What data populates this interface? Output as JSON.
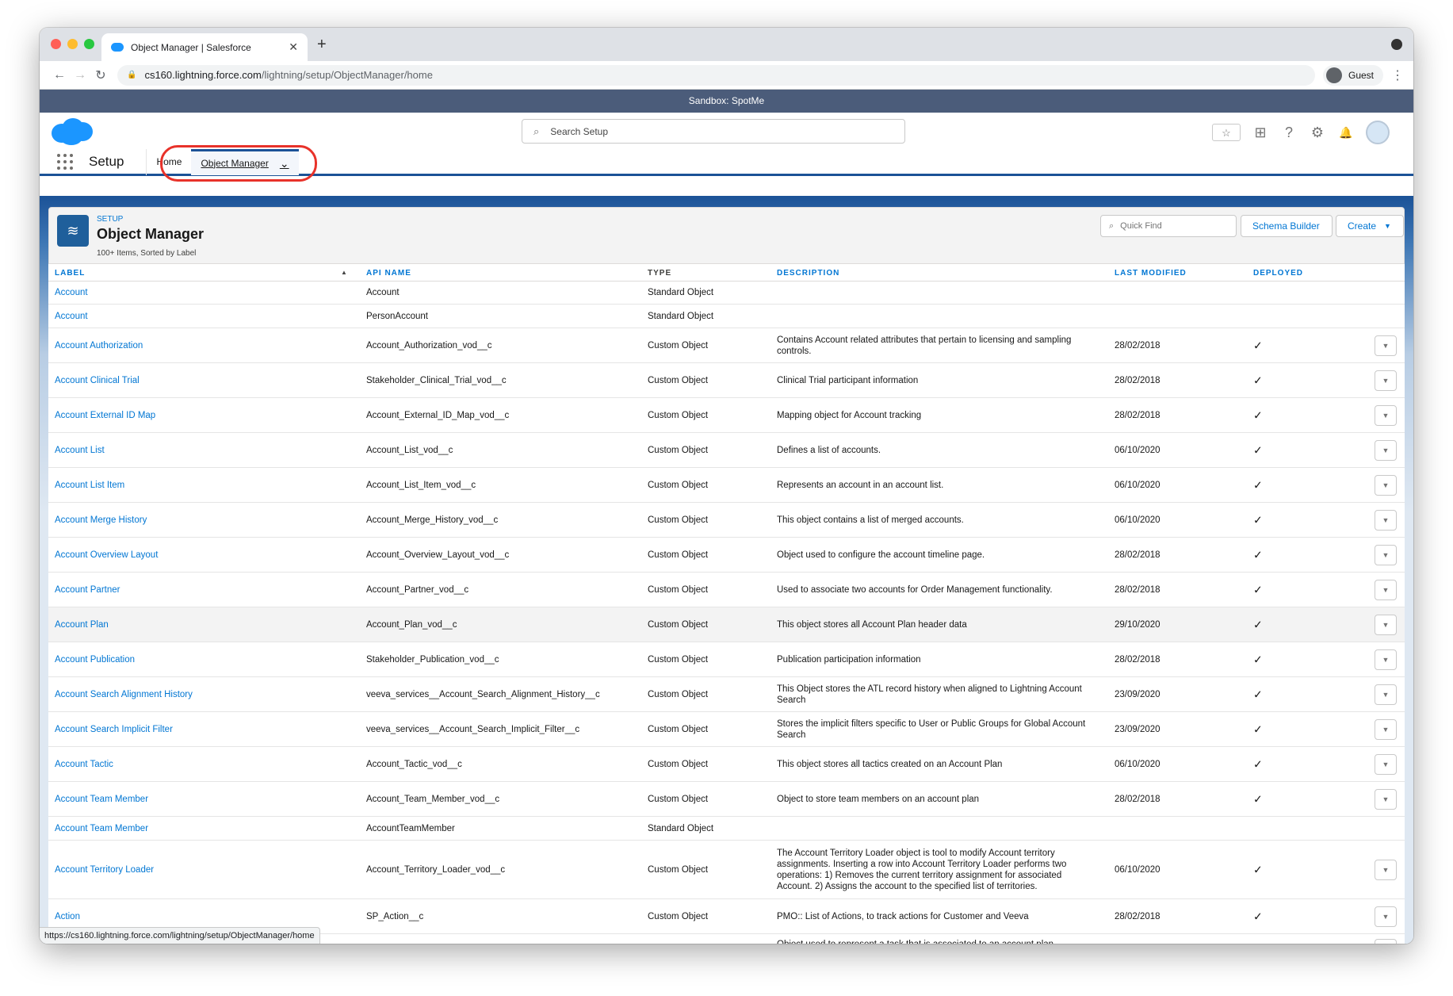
{
  "browser": {
    "tab_title": "Object Manager | Salesforce",
    "tab_close": "✕",
    "new_tab": "+",
    "url_host": "cs160.lightning.force.com",
    "url_path": "/lightning/setup/ObjectManager/home",
    "profile": "Guest",
    "status_url": "https://cs160.lightning.force.com/lightning/setup/ObjectManager/home",
    "back": "←",
    "forward": "→",
    "reload": "↻",
    "kebab": "⋮"
  },
  "sandbox_banner": "Sandbox: SpotMe",
  "header": {
    "search_placeholder": "Search Setup",
    "search_icon": "⌕",
    "icons": [
      "☆",
      "⊞",
      "?",
      "⚙",
      "🔔"
    ]
  },
  "appnav": {
    "app_name": "Setup",
    "home_label": "Home",
    "active_tab": "Object Manager",
    "chevron": "⌄"
  },
  "page": {
    "setup_label": "SETUP",
    "title": "Object Manager",
    "subtitle": "100+ Items, Sorted by Label",
    "quick_find_placeholder": "Quick Find",
    "schema_builder": "Schema Builder",
    "create": "Create",
    "create_caret": "▼"
  },
  "table": {
    "columns": {
      "label": "LABEL",
      "sort_arrow": "▲",
      "api_name": "API NAME",
      "type": "TYPE",
      "description": "DESCRIPTION",
      "last_modified": "LAST MODIFIED",
      "deployed": "DEPLOYED"
    },
    "rows": [
      {
        "label": "Account",
        "api": "Account",
        "type": "Standard Object",
        "desc": "",
        "mod": "",
        "dep": "",
        "action": false,
        "h": 29
      },
      {
        "label": "Account",
        "api": "PersonAccount",
        "type": "Standard Object",
        "desc": "",
        "mod": "",
        "dep": "",
        "action": false,
        "h": 30
      },
      {
        "label": "Account Authorization",
        "api": "Account_Authorization_vod__c",
        "type": "Custom Object",
        "desc": "Contains Account related attributes that pertain to licensing and sampling controls.",
        "mod": "28/02/2018",
        "dep": "✓",
        "action": true,
        "h": 44
      },
      {
        "label": "Account Clinical Trial",
        "api": "Stakeholder_Clinical_Trial_vod__c",
        "type": "Custom Object",
        "desc": "Clinical Trial participant information",
        "mod": "28/02/2018",
        "dep": "✓",
        "action": true,
        "h": 44
      },
      {
        "label": "Account External ID Map",
        "api": "Account_External_ID_Map_vod__c",
        "type": "Custom Object",
        "desc": "Mapping object for Account tracking",
        "mod": "28/02/2018",
        "dep": "✓",
        "action": true,
        "h": 44
      },
      {
        "label": "Account List",
        "api": "Account_List_vod__c",
        "type": "Custom Object",
        "desc": "Defines a list of accounts.",
        "mod": "06/10/2020",
        "dep": "✓",
        "action": true,
        "h": 44
      },
      {
        "label": "Account List Item",
        "api": "Account_List_Item_vod__c",
        "type": "Custom Object",
        "desc": "Represents an account in an account list.",
        "mod": "06/10/2020",
        "dep": "✓",
        "action": true,
        "h": 44
      },
      {
        "label": "Account Merge History",
        "api": "Account_Merge_History_vod__c",
        "type": "Custom Object",
        "desc": "This object contains a list of merged accounts.",
        "mod": "06/10/2020",
        "dep": "✓",
        "action": true,
        "h": 44
      },
      {
        "label": "Account Overview Layout",
        "api": "Account_Overview_Layout_vod__c",
        "type": "Custom Object",
        "desc": "Object used to configure the account timeline page.",
        "mod": "28/02/2018",
        "dep": "✓",
        "action": true,
        "h": 44
      },
      {
        "label": "Account Partner",
        "api": "Account_Partner_vod__c",
        "type": "Custom Object",
        "desc": "Used to associate two accounts for Order Management functionality.",
        "mod": "28/02/2018",
        "dep": "✓",
        "action": true,
        "h": 44
      },
      {
        "label": "Account Plan",
        "api": "Account_Plan_vod__c",
        "type": "Custom Object",
        "desc": "This object stores all Account Plan header data",
        "mod": "29/10/2020",
        "dep": "✓",
        "action": true,
        "h": 44,
        "hl": true
      },
      {
        "label": "Account Publication",
        "api": "Stakeholder_Publication_vod__c",
        "type": "Custom Object",
        "desc": "Publication participation information",
        "mod": "28/02/2018",
        "dep": "✓",
        "action": true,
        "h": 44
      },
      {
        "label": "Account Search Alignment History",
        "api": "veeva_services__Account_Search_Alignment_History__c",
        "type": "Custom Object",
        "desc": "This Object stores the ATL record history when aligned to Lightning Account Search",
        "mod": "23/09/2020",
        "dep": "✓",
        "action": true,
        "h": 44
      },
      {
        "label": "Account Search Implicit Filter",
        "api": "veeva_services__Account_Search_Implicit_Filter__c",
        "type": "Custom Object",
        "desc": "Stores the implicit filters specific to User or Public Groups for Global Account Search",
        "mod": "23/09/2020",
        "dep": "✓",
        "action": true,
        "h": 44
      },
      {
        "label": "Account Tactic",
        "api": "Account_Tactic_vod__c",
        "type": "Custom Object",
        "desc": "This object stores all tactics created on an Account Plan",
        "mod": "06/10/2020",
        "dep": "✓",
        "action": true,
        "h": 44
      },
      {
        "label": "Account Team Member",
        "api": "Account_Team_Member_vod__c",
        "type": "Custom Object",
        "desc": "Object to store team members on an account plan",
        "mod": "28/02/2018",
        "dep": "✓",
        "action": true,
        "h": 44
      },
      {
        "label": "Account Team Member",
        "api": "AccountTeamMember",
        "type": "Standard Object",
        "desc": "",
        "mod": "",
        "dep": "",
        "action": false,
        "h": 30
      },
      {
        "label": "Account Territory Loader",
        "api": "Account_Territory_Loader_vod__c",
        "type": "Custom Object",
        "desc": "The Account Territory Loader object is tool to modify Account territory assignments. Inserting a row into Account Territory Loader performs two operations: 1) Removes the current territory assignment for associated Account. 2) Assigns the account to the specified list of territories.",
        "mod": "06/10/2020",
        "dep": "✓",
        "action": true,
        "h": 74
      },
      {
        "label": "Action",
        "api": "SP_Action__c",
        "type": "Custom Object",
        "desc": "PMO:: List of Actions, to track actions for Customer and Veeva",
        "mod": "28/02/2018",
        "dep": "✓",
        "action": true,
        "h": 44
      },
      {
        "label": "",
        "api": "",
        "type": "",
        "desc": "Object used to represent a task that is associated to an account plan",
        "mod": "",
        "dep": "",
        "action": true,
        "h": 44,
        "partial": true
      }
    ],
    "action_caret": "▼"
  }
}
